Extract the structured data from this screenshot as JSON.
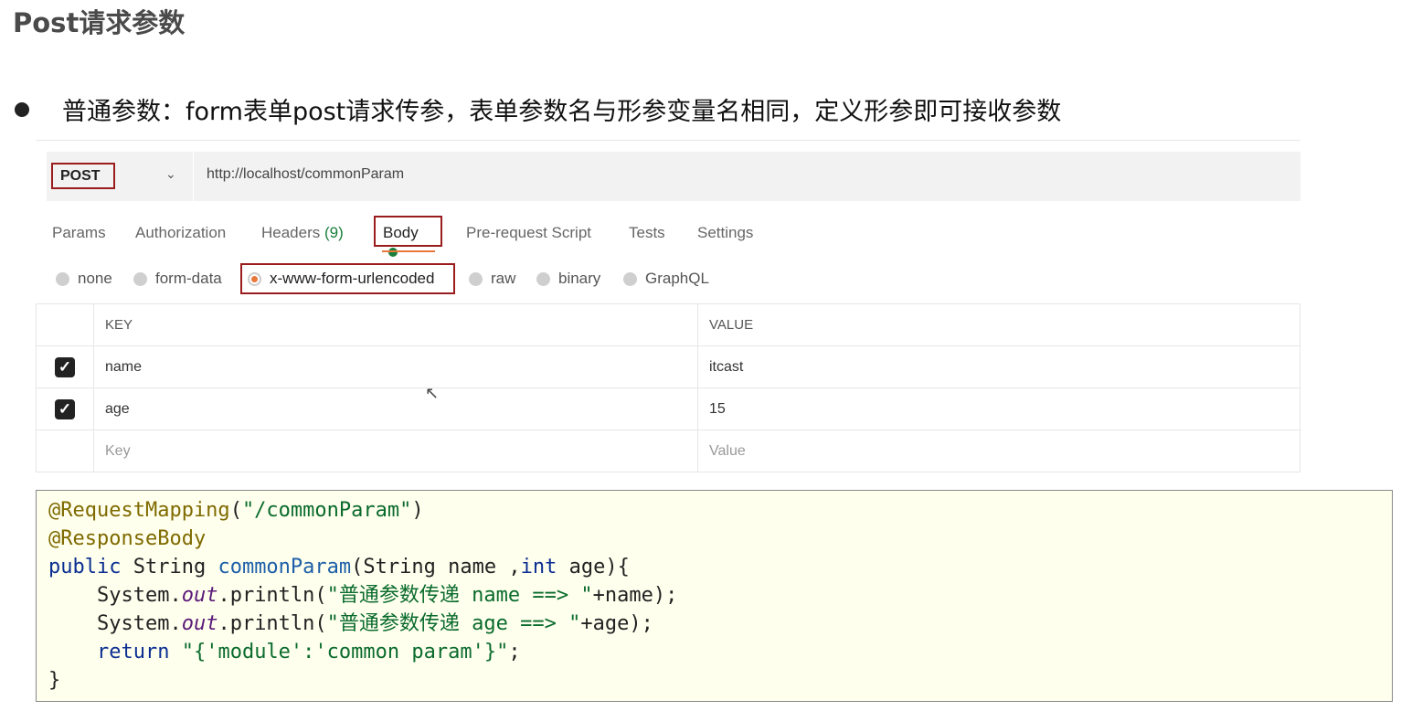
{
  "title": "Post请求参数",
  "bullet": "普通参数：form表单post请求传参，表单参数名与形参变量名相同，定义形参即可接收参数",
  "request": {
    "method": "POST",
    "url": "http://localhost/commonParam"
  },
  "tabs": {
    "params": "Params",
    "authorization": "Authorization",
    "headers": "Headers",
    "headers_count": "(9)",
    "body": "Body",
    "prerequest": "Pre-request Script",
    "tests": "Tests",
    "settings": "Settings"
  },
  "body_types": {
    "none": "none",
    "form_data": "form-data",
    "urlencoded": "x-www-form-urlencoded",
    "raw": "raw",
    "binary": "binary",
    "graphql": "GraphQL",
    "selected": "x-www-form-urlencoded"
  },
  "table": {
    "headers": {
      "key": "KEY",
      "value": "VALUE"
    },
    "rows": [
      {
        "key": "name",
        "value": "itcast",
        "checked": true
      },
      {
        "key": "age",
        "value": "15",
        "checked": true
      }
    ],
    "placeholder": {
      "key": "Key",
      "value": "Value"
    }
  },
  "code": {
    "l1_anno": "@RequestMapping",
    "l1_open": "(",
    "l1_str": "\"/commonParam\"",
    "l1_close": ")",
    "l2_anno": "@ResponseBody",
    "l3_kw": "public",
    "l3_type": " String ",
    "l3_meth": "commonParam",
    "l3_p1": "(String name ,",
    "l3_kw2": "int",
    "l3_p2": " age){",
    "l4_pre": "    System.",
    "l4_out": "out",
    "l4_call": ".println(",
    "l4_str": "\"普通参数传递 name ==> \"",
    "l4_rest": "+name);",
    "l5_pre": "    System.",
    "l5_out": "out",
    "l5_call": ".println(",
    "l5_str": "\"普通参数传递 age ==> \"",
    "l5_rest": "+age);",
    "l6_pre": "    ",
    "l6_kw": "return",
    "l6_sp": " ",
    "l6_str": "\"{'module':'common param'}\"",
    "l6_rest": ";",
    "l7": "}"
  },
  "colors": {
    "highlight_box": "#9b1c1c",
    "accent_orange": "#e8793a",
    "green": "#1a7f3c",
    "code_bg": "#ffffee"
  }
}
